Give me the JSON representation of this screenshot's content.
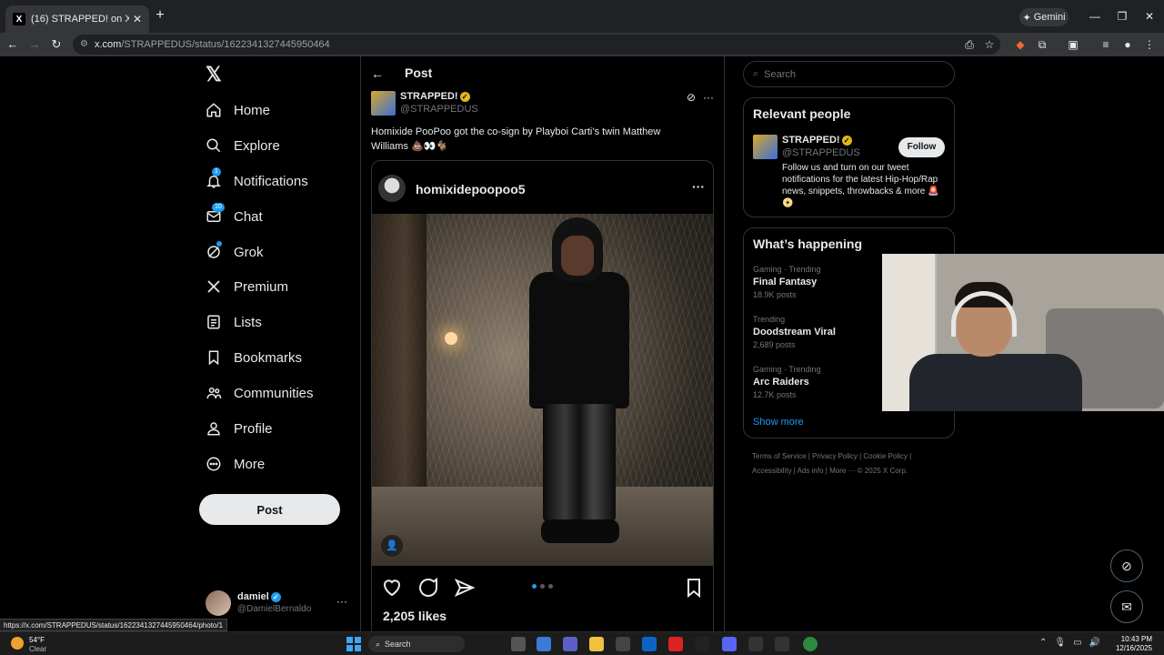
{
  "browser": {
    "tab_title": "(16) STRAPPED! on X: \"Homixid",
    "tab_favicon": "X",
    "new_tab": "+",
    "gemini_label": "Gemini",
    "url_site": "x.com",
    "url_path": "/STRAPPEDUS/status/1622341327445950464",
    "status_url": "https://x.com/STRAPPEDUS/status/1622341327445950464/photo/1"
  },
  "sidebar": {
    "items": [
      {
        "label": "Home",
        "icon": "home-icon"
      },
      {
        "label": "Explore",
        "icon": "search-icon"
      },
      {
        "label": "Notifications",
        "icon": "bell-icon",
        "badge": "1"
      },
      {
        "label": "Chat",
        "icon": "mail-icon",
        "badge": "10"
      },
      {
        "label": "Grok",
        "icon": "grok-icon"
      },
      {
        "label": "Premium",
        "icon": "x-icon"
      },
      {
        "label": "Lists",
        "icon": "list-icon"
      },
      {
        "label": "Bookmarks",
        "icon": "bookmark-icon"
      },
      {
        "label": "Communities",
        "icon": "people-icon"
      },
      {
        "label": "Profile",
        "icon": "person-icon"
      },
      {
        "label": "More",
        "icon": "more-circle-icon"
      }
    ],
    "post_button": "Post",
    "account": {
      "name": "damiel",
      "handle": "@DamielBernaldo",
      "more": "···"
    }
  },
  "post": {
    "header": "Post",
    "author": "STRAPPED!",
    "handle": "@STRAPPEDUS",
    "text": "Homixide PooPoo got the co-sign by Playboi Carti’s twin Matthew Williams 💩👀🐐",
    "embed": {
      "username": "homixidepoopoo5",
      "likes": "2,205 likes"
    }
  },
  "right": {
    "search_placeholder": "Search",
    "relevant": {
      "title": "Relevant people",
      "name": "STRAPPED!",
      "handle": "@STRAPPEDUS",
      "follow_label": "Follow",
      "bio": "Follow us and turn on our tweet notifications for the latest Hip-Hop/Rap news, snippets, throwbacks & more 🚨📀"
    },
    "happening": {
      "title": "What’s happening",
      "trends": [
        {
          "context": "Gaming · Trending",
          "title": "Final Fantasy",
          "count": "18.9K posts"
        },
        {
          "context": "Trending",
          "title": "Doodstream Viral",
          "count": "2,689 posts"
        },
        {
          "context": "Gaming · Trending",
          "title": "Arc Raiders",
          "count": "12.7K posts"
        }
      ],
      "show_more": "Show more"
    },
    "footer": {
      "line1": "Terms of Service  |  Privacy Policy  |  Cookie Policy  |",
      "line2": "Accessibility  |  Ads info  |  More ···  © 2025 X Corp."
    }
  },
  "taskbar": {
    "temp": "54°F",
    "condition": "Clear",
    "search_label": "Search",
    "time": "10:43 PM",
    "date": "12/16/2025"
  },
  "colors": {
    "accent": "#1d9bf0",
    "background": "#000000",
    "text": "#e7e9ea",
    "muted": "#71767b"
  }
}
